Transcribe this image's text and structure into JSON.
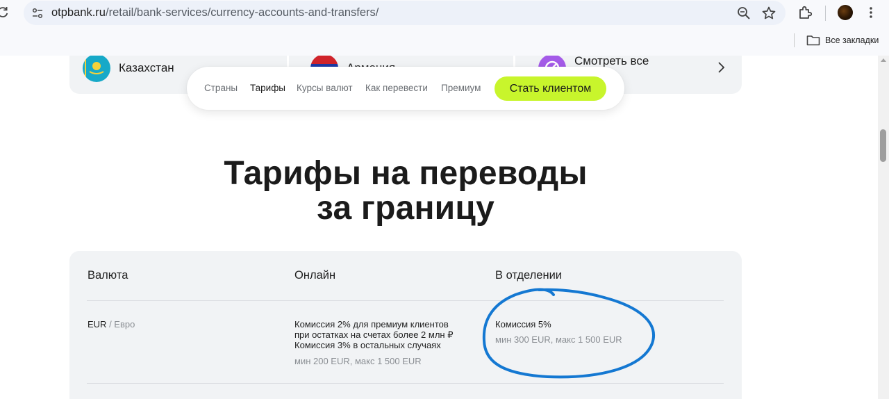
{
  "browser": {
    "url_host": "otpbank.ru",
    "url_path": "/retail/bank-services/currency-accounts-and-transfers/",
    "bookmarks_label": "Все закладки"
  },
  "countries": {
    "items": [
      {
        "label": "Казахстан"
      },
      {
        "label": "Армения"
      },
      {
        "label": "Смотреть все"
      }
    ]
  },
  "nav": {
    "items": [
      {
        "label": "Страны"
      },
      {
        "label": "Тарифы"
      },
      {
        "label": "Курсы валют"
      },
      {
        "label": "Как перевести"
      },
      {
        "label": "Премиум"
      }
    ],
    "cta_label": "Стать клиентом"
  },
  "heading": {
    "line1": "Тарифы на переводы",
    "line2": "за границу"
  },
  "table": {
    "columns": [
      "Валюта",
      "Онлайн",
      "В отделении"
    ],
    "rows": [
      {
        "currency_code": "EUR",
        "currency_name": " / Евро",
        "online_lines": [
          "Комиссия 2% для премиум клиентов",
          "при остатках на счетах более 2 млн ₽",
          "Комиссия 3% в остальных случаях"
        ],
        "online_limits": "мин 200 EUR, макс 1 500 EUR",
        "branch_main": "Комиссия 5%",
        "branch_limits": "мин 300 EUR, макс 1 500 EUR"
      }
    ]
  },
  "colors": {
    "cta": "#c8f52c",
    "panel": "#f1f3f5",
    "annotation": "#1478d2"
  }
}
